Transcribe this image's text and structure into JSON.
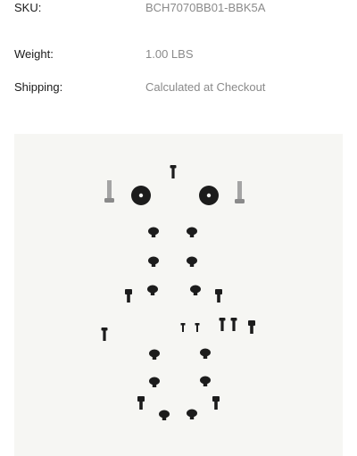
{
  "specs": {
    "sku": {
      "label": "SKU:",
      "value": "BCH7070BB01-BBK5A"
    },
    "weight": {
      "label": "Weight:",
      "value": "1.00 LBS"
    },
    "shipping": {
      "label": "Shipping:",
      "value": "Calculated at Checkout"
    }
  },
  "image": {
    "subject": "screw-kit-photo",
    "background_color": "#f6f6f3",
    "part_color": "#1c1c1c",
    "metal_color": "#9a9a9a"
  }
}
